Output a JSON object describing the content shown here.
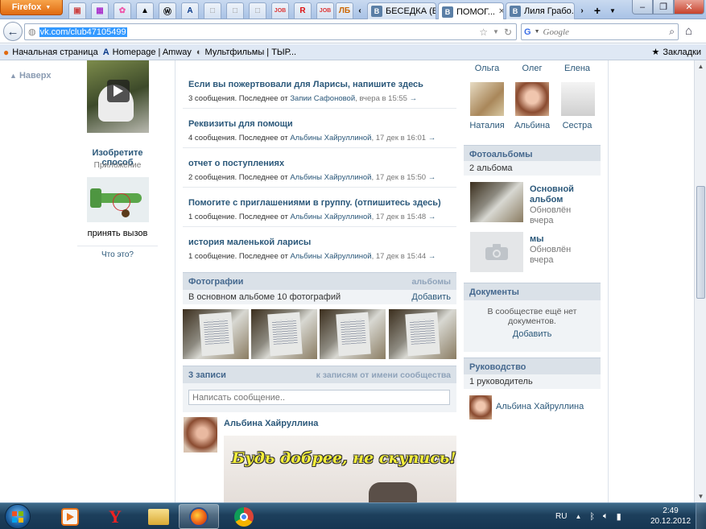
{
  "browser": {
    "app_button": "Firefox",
    "pinned_tabs": [
      "A",
      "R",
      "ЛБ"
    ],
    "tabs": [
      {
        "label": "БЕСЕДКА (Б..."
      },
      {
        "label": "ПОМОГ..."
      },
      {
        "label": "Лиля Грабо..."
      }
    ],
    "url": "vk.com/club47105499",
    "search_engine": "Google",
    "search_placeholder": "Google",
    "bookmarks": [
      "Начальная страница",
      "Homepage | Amway",
      "Мультфильмы | ТЫР..."
    ],
    "bookmarks_menu": "Закладки"
  },
  "page": {
    "to_top": "Наверх",
    "app": {
      "title": "Изобретите способ",
      "subtitle": "Приложение",
      "action": "принять вызов",
      "what_is": "Что это?"
    },
    "topics": [
      {
        "title": "Если вы пожертвовали для Ларисы, напишите здесь",
        "count": "3 сообщения. Последнее от",
        "author": "Запии Сафоновой",
        "date": ", вчера в 15:55",
        "arrow": "→"
      },
      {
        "title": "Реквизиты для помощи",
        "count": "4 сообщения. Последнее от",
        "author": "Альбины Хайруллиной",
        "date": ", 17 дек в 16:01",
        "arrow": "→"
      },
      {
        "title": "отчет о поступлениях",
        "count": "2 сообщения. Последнее от",
        "author": "Альбины Хайруллиной",
        "date": ", 17 дек в 15:50",
        "arrow": "→"
      },
      {
        "title": "Помогите с приглашениями в группу. (отпишитесь здесь)",
        "count": "1 сообщение. Последнее от",
        "author": "Альбины Хайруллиной",
        "date": ", 17 дек в 15:48",
        "arrow": "→"
      },
      {
        "title": "история маленькой ларисы",
        "count": "1 сообщение. Последнее от",
        "author": "Альбины Хайруллиной",
        "date": ", 17 дек в 15:44",
        "arrow": "→"
      }
    ],
    "photos": {
      "title": "Фотографии",
      "albums_link": "альбомы",
      "summary": "В основном альбоме 10 фотографий",
      "add": "Добавить"
    },
    "wall": {
      "count": "3 записи",
      "link": "к записям от имени сообщества",
      "placeholder": "Написать сообщение..",
      "post_author": "Альбина Хайруллина",
      "post_image_text": "Будь добрее, не скупись!"
    },
    "members_top": [
      "Ольга",
      "Олег",
      "Елена"
    ],
    "members": [
      "Наталия",
      "Альбина",
      "Сестра"
    ],
    "albums": {
      "title": "Фотоальбомы",
      "count": "2 альбома",
      "items": [
        {
          "name_line1": "Основной",
          "name_line2": "альбом",
          "updated1": "Обновлён",
          "updated2": "вчера"
        },
        {
          "name_line1": "мы",
          "name_line2": "",
          "updated1": "Обновлён",
          "updated2": "вчера"
        }
      ]
    },
    "documents": {
      "title": "Документы",
      "empty_line1": "В сообществе ещё нет",
      "empty_line2": "документов.",
      "add": "Добавить"
    },
    "management": {
      "title": "Руководство",
      "count": "1 руководитель",
      "person": "Альбина Хайруллина"
    }
  },
  "taskbar": {
    "lang": "RU",
    "time": "2:49",
    "date": "20.12.2012"
  },
  "colors": {
    "vk_link": "#2b587a",
    "section_header": "#dae1e8",
    "firefox_orange": "#e06a10"
  }
}
